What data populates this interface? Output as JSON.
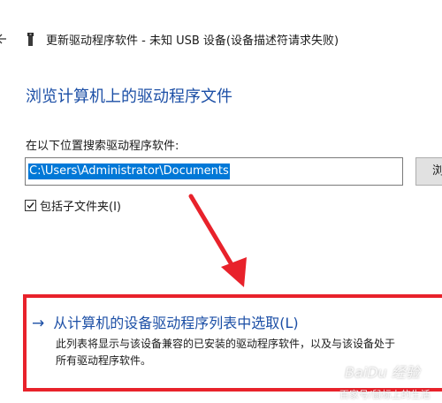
{
  "window": {
    "title": "更新驱动程序软件 - 未知 USB 设备(设备描述符请求失败)",
    "back_icon": "back-arrow-icon",
    "device_icon": "usb-device-icon"
  },
  "main": {
    "heading": "浏览计算机上的驱动程序文件",
    "search_label": "在以下位置搜索驱动程序软件:",
    "path_value": "C:\\Users\\Administrator\\Documents",
    "browse_label": "浏",
    "include_subfolders": {
      "label": "包括子文件夹(I)",
      "checked": true
    }
  },
  "pick_option": {
    "arrow": "→",
    "label": "从计算机的设备驱动程序列表中选取(L)",
    "description_line1": "此列表将显示与该设备兼容的已安装的驱动程序软件，以及与该设备处于",
    "description_line2": "所有驱动程序软件。"
  },
  "annotation": {
    "color": "#e8222b"
  },
  "colors": {
    "accent": "#1c4fa6",
    "selection": "#0078d7"
  }
}
